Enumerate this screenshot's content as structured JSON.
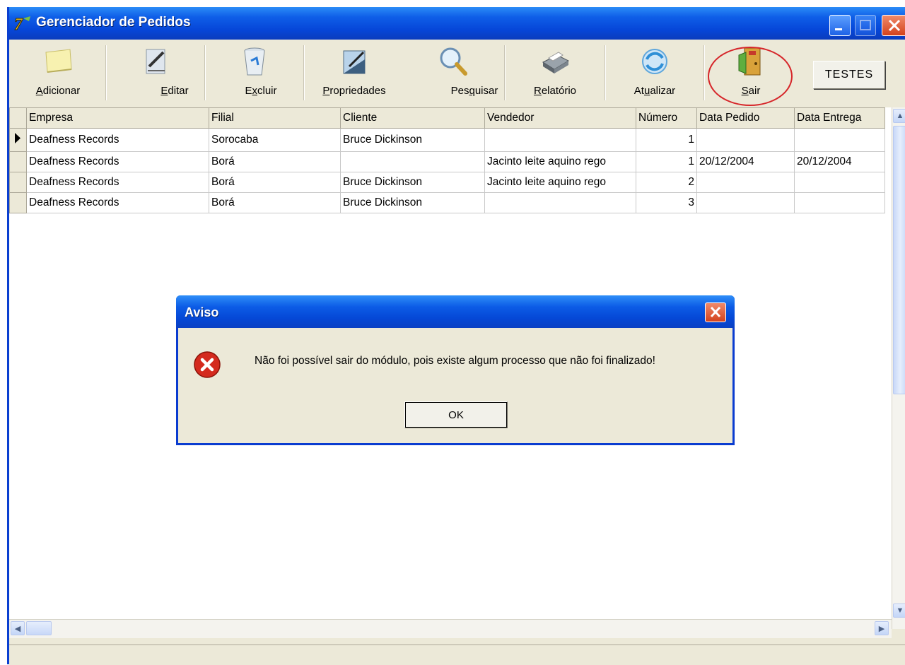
{
  "window": {
    "title": "Gerenciador de Pedidos"
  },
  "toolbar": {
    "items": [
      {
        "label_pre": "",
        "label_ul": "A",
        "label_post": "dicionar",
        "icon": "note-icon"
      },
      {
        "label_pre": "",
        "label_ul": "E",
        "label_post": "ditar",
        "icon": "edit-icon"
      },
      {
        "label_pre": "E",
        "label_ul": "x",
        "label_post": "cluir",
        "icon": "recycle-bin-icon"
      },
      {
        "label_pre": "",
        "label_ul": "P",
        "label_post": "ropriedades",
        "icon": "properties-icon"
      },
      {
        "label_pre": "Pes",
        "label_ul": "q",
        "label_post": "uisar",
        "icon": "magnifier-icon"
      },
      {
        "label_pre": "",
        "label_ul": "R",
        "label_post": "elatório",
        "icon": "printer-icon"
      },
      {
        "label_pre": "At",
        "label_ul": "u",
        "label_post": "alizar",
        "icon": "refresh-icon"
      },
      {
        "label_pre": "",
        "label_ul": "S",
        "label_post": "air",
        "icon": "exit-door-icon"
      }
    ],
    "testes_label": "TESTES"
  },
  "grid": {
    "columns": [
      "Empresa",
      "Filial",
      "Cliente",
      "Vendedor",
      "Número",
      "Data Pedido",
      "Data Entrega"
    ],
    "rows": [
      [
        "Deafness Records",
        "Sorocaba",
        "Bruce Dickinson",
        "",
        "1",
        "",
        ""
      ],
      [
        "Deafness Records",
        "Borá",
        "",
        "Jacinto leite aquino rego",
        "1",
        "20/12/2004",
        "20/12/2004"
      ],
      [
        "Deafness Records",
        "Borá",
        "Bruce Dickinson",
        "Jacinto leite aquino rego",
        "2",
        "",
        ""
      ],
      [
        "Deafness Records",
        "Borá",
        "Bruce Dickinson",
        "",
        "3",
        "",
        ""
      ]
    ],
    "current_row": 0
  },
  "dialog": {
    "title": "Aviso",
    "message": "Não foi possível sair do módulo, pois existe algum processo que não foi finalizado!",
    "ok_label": "OK",
    "icon": "error-icon"
  },
  "colors": {
    "titlebar": "#0a4ad8",
    "face": "#ece9d8",
    "highlight": "#d6262a"
  }
}
